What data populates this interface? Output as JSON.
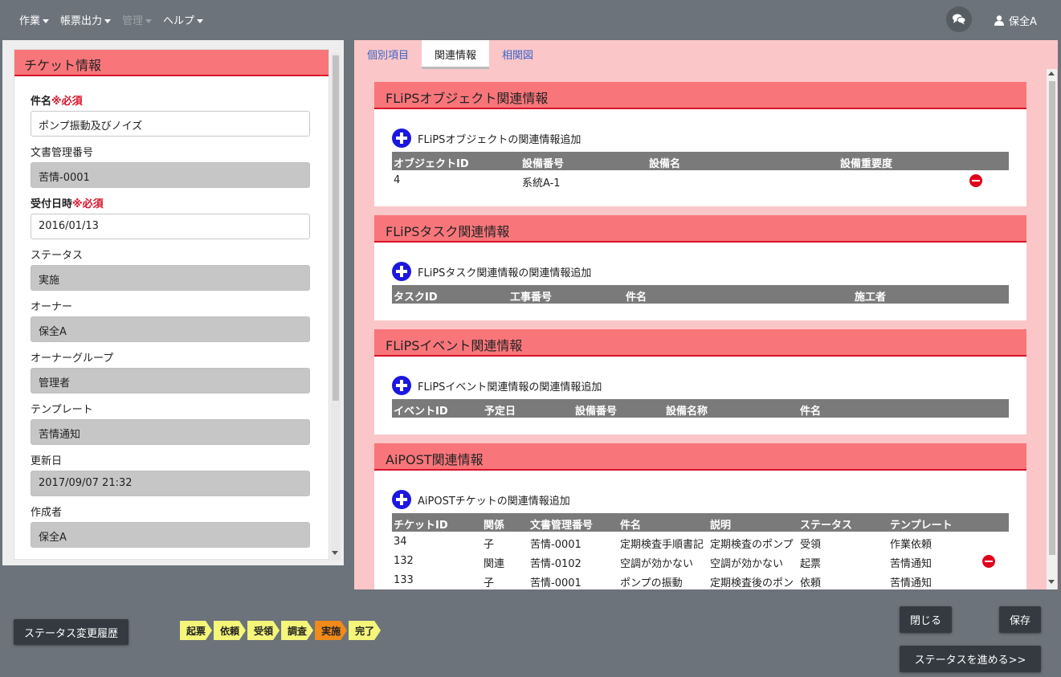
{
  "nav": {
    "items": [
      {
        "label": "作業",
        "disabled": false
      },
      {
        "label": "帳票出力",
        "disabled": false
      },
      {
        "label": "管理",
        "disabled": true
      },
      {
        "label": "ヘルプ",
        "disabled": false
      }
    ],
    "user": "保全A"
  },
  "ticket": {
    "header": "チケット情報",
    "fields": [
      {
        "label": "件名",
        "required": "※必須",
        "value": "ポンプ振動及びノイズ",
        "editable": true
      },
      {
        "label": "文書管理番号",
        "required": "",
        "value": "苦情-0001",
        "editable": false
      },
      {
        "label": "受付日時",
        "required": "※必須",
        "value": "2016/01/13",
        "editable": true
      },
      {
        "label": "ステータス",
        "required": "",
        "value": "実施",
        "editable": false
      },
      {
        "label": "オーナー",
        "required": "",
        "value": "保全A",
        "editable": false
      },
      {
        "label": "オーナーグループ",
        "required": "",
        "value": "管理者",
        "editable": false
      },
      {
        "label": "テンプレート",
        "required": "",
        "value": "苦情通知",
        "editable": false
      },
      {
        "label": "更新日",
        "required": "",
        "value": "2017/09/07 21:32",
        "editable": false
      },
      {
        "label": "作成者",
        "required": "",
        "value": "保全A",
        "editable": false
      }
    ]
  },
  "tabs": [
    {
      "label": "個別項目",
      "active": false
    },
    {
      "label": "関連情報",
      "active": true
    },
    {
      "label": "相関図",
      "active": false
    }
  ],
  "sections": {
    "object": {
      "title": "FLiPSオブジェクト関連情報",
      "add_label": "FLiPSオブジェクトの関連情報追加",
      "columns": [
        "オブジェクトID",
        "設備番号",
        "設備名",
        "設備重要度"
      ],
      "rows": [
        [
          "4",
          "系統A-1",
          "",
          ""
        ]
      ]
    },
    "task": {
      "title": "FLiPSタスク関連情報",
      "add_label": "FLiPSタスク関連情報の関連情報追加",
      "columns": [
        "タスクID",
        "工事番号",
        "件名",
        "施工者"
      ]
    },
    "event": {
      "title": "FLiPSイベント関連情報",
      "add_label": "FLiPSイベント関連情報の関連情報追加",
      "columns": [
        "イベントID",
        "予定日",
        "設備番号",
        "設備名称",
        "件名"
      ]
    },
    "aipost": {
      "title": "AiPOST関連情報",
      "add_label": "AiPOSTチケットの関連情報追加",
      "columns": [
        "チケットID",
        "関係",
        "文書管理番号",
        "件名",
        "説明",
        "ステータス",
        "テンプレート"
      ],
      "rows": [
        [
          "34",
          "子",
          "苦情-0001",
          "定期検査手順書記",
          "定期検査のポンプ",
          "受領",
          "作業依頼"
        ],
        [
          "132",
          "関連",
          "苦情-0102",
          "空調が効かない",
          "空調が効かない",
          "起票",
          "苦情通知"
        ],
        [
          "133",
          "子",
          "苦情-0001",
          "ポンプの振動",
          "定期検査後のポン",
          "依頼",
          "苦情通知"
        ]
      ]
    }
  },
  "bottom": {
    "history_button": "ステータス変更履歴",
    "steps": [
      {
        "label": "起票",
        "current": false
      },
      {
        "label": "依頼",
        "current": false
      },
      {
        "label": "受領",
        "current": false
      },
      {
        "label": "調査",
        "current": false
      },
      {
        "label": "実施",
        "current": true
      },
      {
        "label": "完了",
        "current": false
      }
    ],
    "close_button": "閉じる",
    "save_button": "保存",
    "advance_button": "ステータスを進める>>"
  },
  "colors": {
    "accent_header": "#f8767a",
    "accent_border": "#d7142a",
    "step_default": "#f5f57a",
    "step_current": "#f08a1a"
  }
}
